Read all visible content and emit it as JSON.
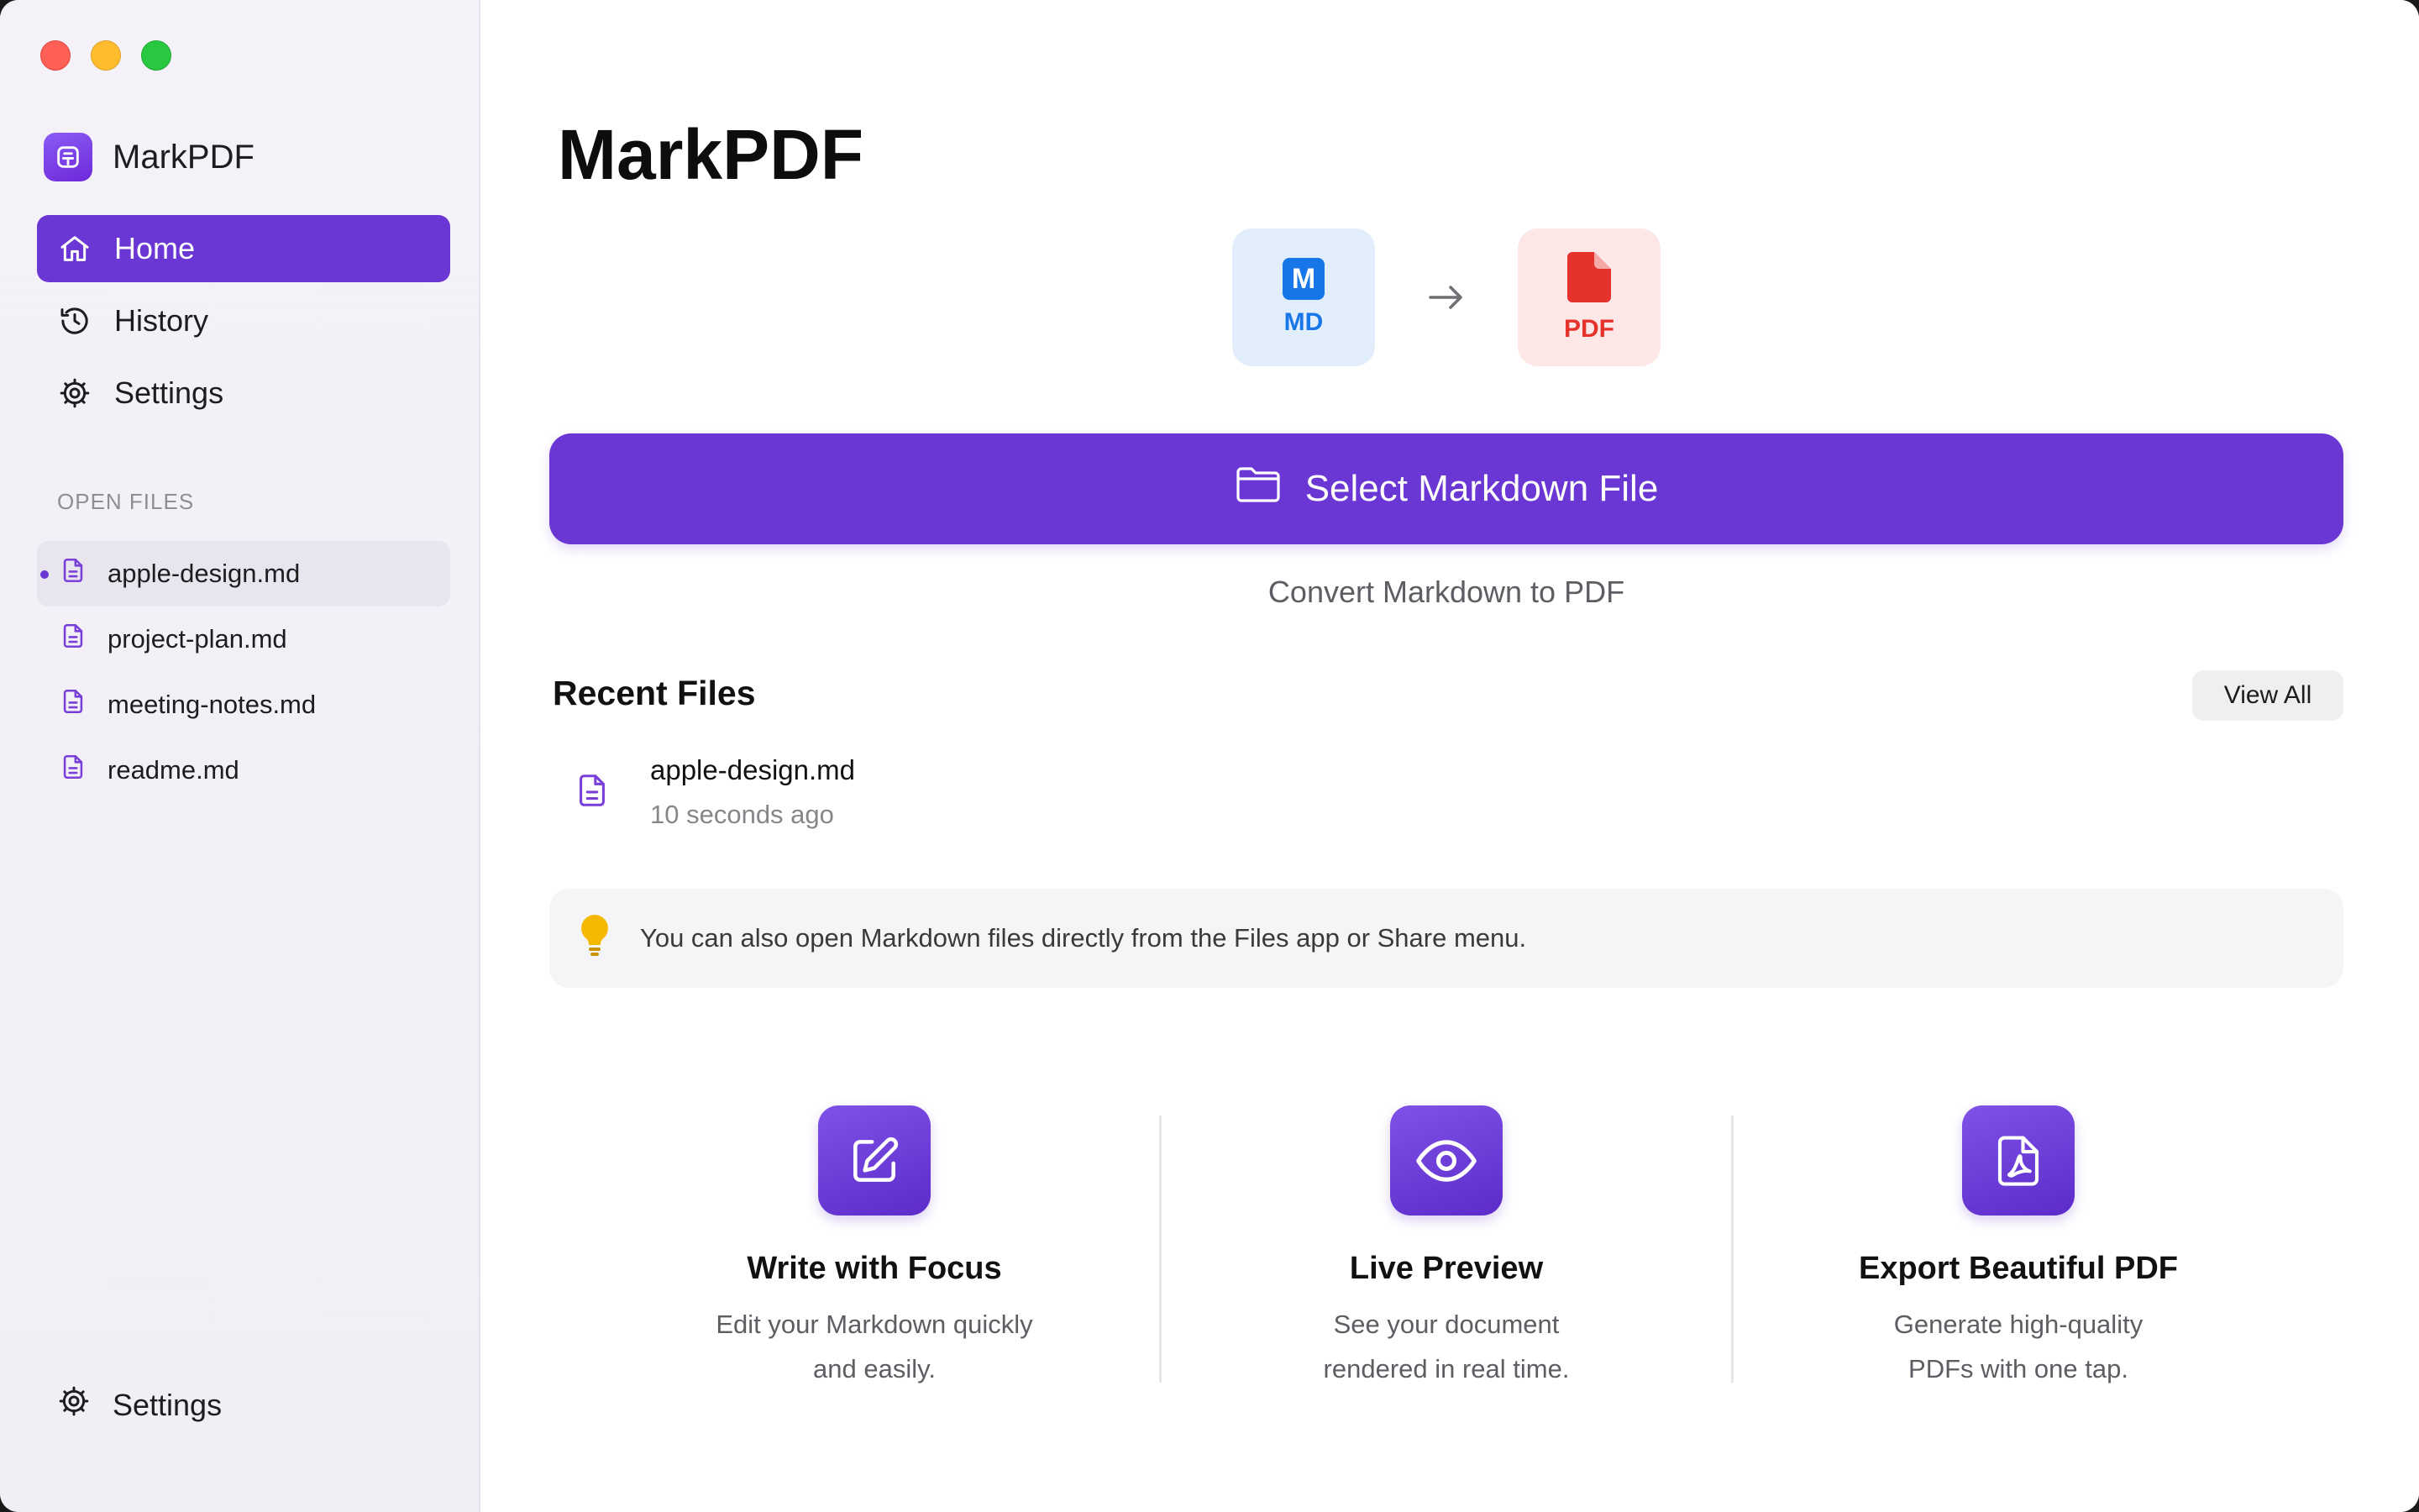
{
  "app": {
    "name": "MarkPDF",
    "window_controls": [
      "close",
      "minimize",
      "zoom"
    ]
  },
  "sidebar": {
    "nav": [
      {
        "label": "Home",
        "icon": "home-icon",
        "active": true
      },
      {
        "label": "History",
        "icon": "history-icon",
        "active": false
      },
      {
        "label": "Settings",
        "icon": "gear-icon",
        "active": false
      }
    ],
    "open_files_label": "OPEN FILES",
    "open_files": [
      {
        "name": "apple-design.md",
        "active": true
      },
      {
        "name": "project-plan.md",
        "active": false
      },
      {
        "name": "meeting-notes.md",
        "active": false
      },
      {
        "name": "readme.md",
        "active": false
      }
    ],
    "bottom_settings_label": "Settings"
  },
  "main": {
    "title": "MarkPDF",
    "from_format": {
      "badge": "M",
      "label": "MD",
      "color": "#1877e8"
    },
    "to_format": {
      "label": "PDF",
      "color": "#e5322d"
    },
    "select_button_label": "Select Markdown File",
    "subtitle": "Convert Markdown to PDF",
    "recent": {
      "title": "Recent Files",
      "view_all_label": "View All",
      "items": [
        {
          "name": "apple-design.md",
          "time": "10 seconds ago"
        }
      ]
    },
    "tip": "You can also open Markdown files directly from the Files app or Share menu.",
    "features": [
      {
        "icon": "edit-icon",
        "title": "Write with Focus",
        "desc": "Edit your Markdown quickly and easily."
      },
      {
        "icon": "eye-icon",
        "title": "Live Preview",
        "desc": "See your document rendered in real time."
      },
      {
        "icon": "pdf-icon",
        "title": "Export Beautiful PDF",
        "desc": "Generate high-quality PDFs with one tap."
      }
    ]
  },
  "colors": {
    "accent": "#6a36d4",
    "sidebar_bg": "#f4f2f8",
    "tip_bulb": "#f5b800"
  }
}
